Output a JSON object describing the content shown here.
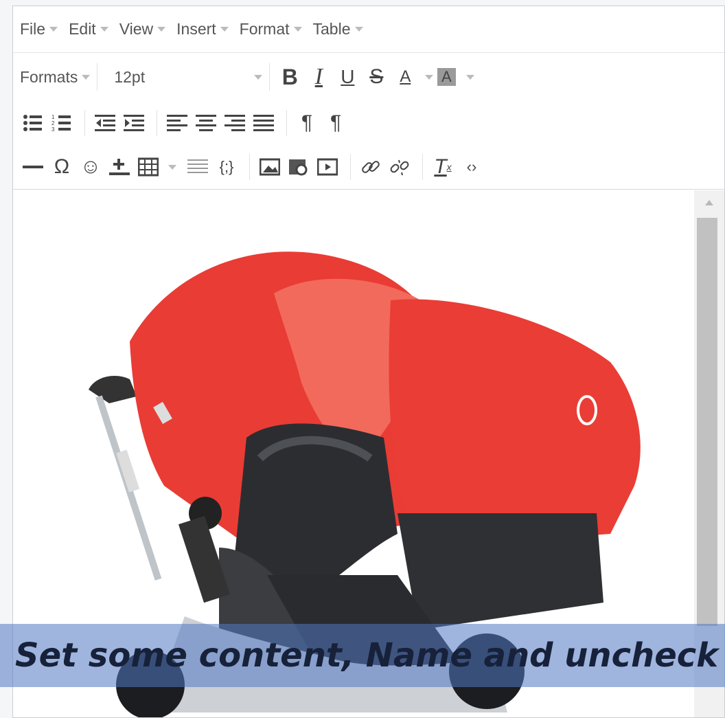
{
  "menubar": [
    "File",
    "Edit",
    "View",
    "Insert",
    "Format",
    "Table"
  ],
  "toolbar": {
    "formats_label": "Formats",
    "font_size": "12pt",
    "row2": [
      "B",
      "I",
      "U",
      "S",
      "A",
      "A"
    ],
    "row3_icons": [
      "bullet-list-icon",
      "numbered-list-icon",
      "outdent-icon",
      "indent-icon",
      "align-left-icon",
      "align-center-icon",
      "align-right-icon",
      "justify-icon",
      "ltr-icon",
      "rtl-icon"
    ],
    "row4_icons": [
      "horizontal-rule-icon",
      "special-char-icon",
      "emoticon-icon",
      "insert-icon",
      "table-icon",
      "list-icon",
      "code-icon",
      "image-icon",
      "media-icon",
      "embed-icon",
      "link-icon",
      "unlink-icon",
      "clear-format-icon",
      "source-code-icon"
    ]
  },
  "caption": "Set some content, Name and uncheck S"
}
